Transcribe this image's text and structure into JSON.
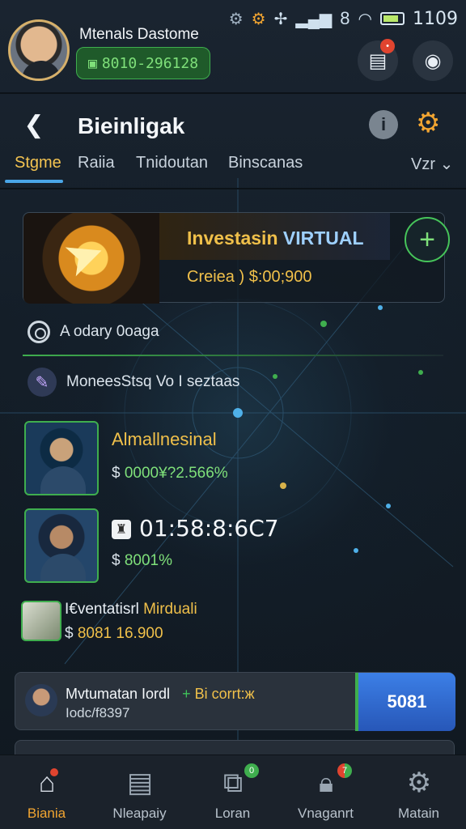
{
  "status_bar": {
    "time": "1109",
    "signal_text": "8"
  },
  "profile": {
    "name": "Mtenals Dastome",
    "balance": "8010-296128"
  },
  "header": {
    "title": "Bieinligak"
  },
  "tabs": [
    {
      "label": "Stgme",
      "active": true
    },
    {
      "label": "Raiia",
      "active": false
    },
    {
      "label": "Tnidoutan",
      "active": false
    },
    {
      "label": "Binscanas",
      "active": false
    }
  ],
  "tab_dropdown": "Vzr",
  "invest_card": {
    "title": "Investasin",
    "title_accent": "VIRTUAL",
    "amount": "Creiea ) $:00;900"
  },
  "sections": {
    "activity": "A odary 0oaga",
    "mix": "MoneesStsq Vo I seztaas"
  },
  "assets": [
    {
      "title": "Almallnesinal",
      "value_prefix": "$",
      "value": "0000¥?2.566%"
    },
    {
      "timer": "01:58:8:6C7",
      "value_prefix": "$",
      "value": "8001%"
    }
  ],
  "mini_asset": {
    "title_prefix": "I€ventatisrl",
    "title": "Mirduali",
    "value_prefix": "$",
    "value": "8081 16.900"
  },
  "promo": {
    "title": "Mvtumatan Iordl",
    "tag": "Bi corrt:ж",
    "subtitle": "Iodc/f8397",
    "button": "5081"
  },
  "bottom_nav": [
    {
      "label": "Biania",
      "icon": "home-icon",
      "active": true,
      "badge": ""
    },
    {
      "label": "Nleapaiy",
      "icon": "news-icon",
      "active": false,
      "badge": ""
    },
    {
      "label": "Loran",
      "icon": "ticket-icon",
      "active": false,
      "badge": "0"
    },
    {
      "label": "Vnaganrt",
      "icon": "lock-icon",
      "active": false,
      "badge": "7"
    },
    {
      "label": "Matain",
      "icon": "gear-icon",
      "active": false,
      "badge": ""
    }
  ],
  "colors": {
    "accent_gold": "#f0c04a",
    "accent_green": "#3fae4e",
    "accent_blue": "#4aa6e8",
    "button_blue": "#2757b8"
  }
}
